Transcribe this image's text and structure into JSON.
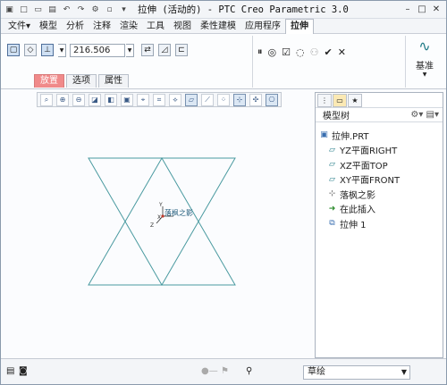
{
  "title_bar": {
    "title": "拉伸 (活动的) - PTC Creo Parametric 3.0",
    "quick_icons": [
      "new-icon",
      "open-icon",
      "save-icon",
      "undo-icon",
      "redo-icon",
      "regenerate-icon",
      "windows-icon",
      "close-window-icon"
    ]
  },
  "menu": {
    "items": [
      "文件▾",
      "模型",
      "分析",
      "注释",
      "渲染",
      "工具",
      "视图",
      "柔性建模",
      "应用程序",
      "拉伸"
    ]
  },
  "ribbon": {
    "depth_value": "216.506",
    "datum_label": "基准"
  },
  "tabs": [
    "放置",
    "选项",
    "属性"
  ],
  "model_tree": {
    "title": "模型树",
    "items": [
      {
        "label": "拉伸.PRT",
        "icon": "part-icon"
      },
      {
        "label": "YZ平面RIGHT",
        "icon": "plane-icon"
      },
      {
        "label": "XZ平面TOP",
        "icon": "plane-icon"
      },
      {
        "label": "XY平面FRONT",
        "icon": "plane-icon"
      },
      {
        "label": "落枫之影",
        "icon": "csys-icon"
      },
      {
        "label": "在此插入",
        "icon": "insert-arrow-icon"
      },
      {
        "label": "拉伸 1",
        "icon": "extrude-icon"
      }
    ]
  },
  "canvas": {
    "csys_label": "落枫之影",
    "axis_x": "X",
    "axis_y": "Y",
    "axis_z": "Z"
  },
  "status_bar": {
    "filter_value": "草绘"
  },
  "colors": {
    "sketch": "#4a9aa0",
    "active_tab": "#f08a8a",
    "accent": "#1f7a86"
  }
}
